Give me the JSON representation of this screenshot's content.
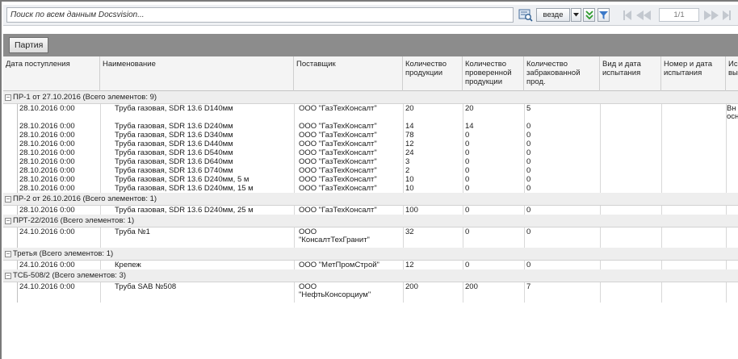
{
  "search": {
    "placeholder": "Поиск по всем данным Docsvision...",
    "scope": "везде",
    "page_indicator": "1/1"
  },
  "toolbar": {
    "group_label": "Партия"
  },
  "columns": [
    "Дата поступления",
    "Наименование",
    "Поставщик",
    "Количество\nпродукции",
    "Количество\nпроверенной\nпродукции",
    "Количество\nзабракованной\nпрод.",
    "Вид и дата\nиспытания",
    "Номер и дата\nиспытания",
    "Ис\nвы"
  ],
  "groups": [
    {
      "title": "ПР-1 от 27.10.2016 (Всего элементов: 9)",
      "rows": [
        {
          "date": "28.10.2016 0:00",
          "name": "Труба газовая, SDR 13.6 D140мм",
          "supplier": "ООО \"ГазТехКонсалт\"",
          "qty": "20",
          "checked": "20",
          "rejected": "5",
          "extra": "Вн\nосн"
        },
        {
          "date": "28.10.2016 0:00",
          "name": "Труба газовая, SDR 13.6 D240мм",
          "supplier": "ООО \"ГазТехКонсалт\"",
          "qty": "14",
          "checked": "14",
          "rejected": "0",
          "extra": ""
        },
        {
          "date": "28.10.2016 0:00",
          "name": "Труба газовая, SDR 13.6 D340мм",
          "supplier": "ООО \"ГазТехКонсалт\"",
          "qty": "78",
          "checked": "0",
          "rejected": "0",
          "extra": ""
        },
        {
          "date": "28.10.2016 0:00",
          "name": "Труба газовая, SDR 13.6 D440мм",
          "supplier": "ООО \"ГазТехКонсалт\"",
          "qty": "12",
          "checked": "0",
          "rejected": "0",
          "extra": ""
        },
        {
          "date": "28.10.2016 0:00",
          "name": "Труба газовая, SDR 13.6 D540мм",
          "supplier": "ООО \"ГазТехКонсалт\"",
          "qty": "24",
          "checked": "0",
          "rejected": "0",
          "extra": ""
        },
        {
          "date": "28.10.2016 0:00",
          "name": "Труба газовая, SDR 13.6 D640мм",
          "supplier": "ООО \"ГазТехКонсалт\"",
          "qty": "3",
          "checked": "0",
          "rejected": "0",
          "extra": ""
        },
        {
          "date": "28.10.2016 0:00",
          "name": "Труба газовая, SDR 13.6 D740мм",
          "supplier": "ООО \"ГазТехКонсалт\"",
          "qty": "2",
          "checked": "0",
          "rejected": "0",
          "extra": ""
        },
        {
          "date": "28.10.2016 0:00",
          "name": "Труба газовая, SDR 13.6 D240мм, 5 м",
          "supplier": "ООО \"ГазТехКонсалт\"",
          "qty": "10",
          "checked": "0",
          "rejected": "0",
          "extra": ""
        },
        {
          "date": "28.10.2016 0:00",
          "name": "Труба газовая, SDR 13.6 D240мм, 15 м",
          "supplier": "ООО \"ГазТехКонсалт\"",
          "qty": "10",
          "checked": "0",
          "rejected": "0",
          "extra": ""
        }
      ]
    },
    {
      "title": "ПР-2 от 26.10.2016 (Всего элементов: 1)",
      "rows": [
        {
          "date": "28.10.2016 0:00",
          "name": "Труба газовая, SDR 13.6 D240мм, 25 м",
          "supplier": "ООО \"ГазТехКонсалт\"",
          "qty": "100",
          "checked": "0",
          "rejected": "0",
          "extra": ""
        }
      ]
    },
    {
      "title": "ПРТ-22/2016 (Всего элементов: 1)",
      "rows": [
        {
          "date": "24.10.2016 0:00",
          "name": "Труба №1",
          "supplier": "ООО\n\"КонсалтТехГранит\"",
          "qty": "32",
          "checked": "0",
          "rejected": "0",
          "extra": ""
        }
      ]
    },
    {
      "title": "Третья (Всего элементов: 1)",
      "rows": [
        {
          "date": "24.10.2016 0:00",
          "name": "Крепеж",
          "supplier": "ООО \"МетПромСтрой\"",
          "qty": "12",
          "checked": "0",
          "rejected": "0",
          "extra": ""
        }
      ]
    },
    {
      "title": "ТСБ-508/2 (Всего элементов: 3)",
      "rows": [
        {
          "date": "24.10.2016 0:00",
          "name": "Труба SAB №508",
          "supplier": "ООО\n\"НефтьКонсорциум\"",
          "qty": "200",
          "checked": "200",
          "rejected": "7",
          "extra": ""
        }
      ]
    }
  ]
}
